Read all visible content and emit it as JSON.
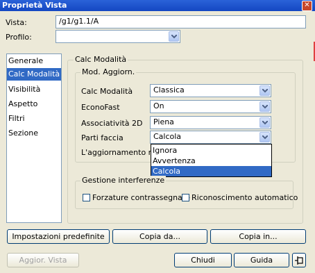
{
  "window": {
    "title": "Proprietà Vista"
  },
  "vista": {
    "label": "Vista:",
    "value": "/g1/g1.1/A"
  },
  "profilo": {
    "label": "Profilo:",
    "value": ""
  },
  "sidebar": {
    "items": [
      {
        "label": "Generale"
      },
      {
        "label": "Calc Modalità",
        "selected": true
      },
      {
        "label": "Visibilità"
      },
      {
        "label": "Aspetto"
      },
      {
        "label": "Filtri"
      },
      {
        "label": "Sezione"
      }
    ]
  },
  "calc": {
    "group_label": "Calc Modalità",
    "mod_group_label": "Mod. Aggiorn.",
    "rows": [
      {
        "label": "Calc Modalità",
        "value": "Classica"
      },
      {
        "label": "EconoFast",
        "value": "On"
      },
      {
        "label": "Associatività 2D",
        "value": "Piena"
      },
      {
        "label": "Parti faccia",
        "value": "Calcola"
      }
    ],
    "truncated_label": "L'aggiornamento mar",
    "dropdown_options": [
      "Ignora",
      "Avvertenza",
      "Calcola"
    ],
    "dropdown_selected": "Calcola"
  },
  "interferenze": {
    "group_label": "Gestione interferenze",
    "forzature_label": "Forzature contrassegnate",
    "riconoscimento_label": "Riconoscimento automatico"
  },
  "buttons": {
    "impostazioni": "Impostazioni predefinite",
    "copia_da": "Copia da...",
    "copia_in": "Copia in...",
    "aggior_vista": "Aggior. Vista",
    "chiudi": "Chiudi",
    "guida": "Guida"
  },
  "icons": {
    "close": "close-icon",
    "pin": "pin-icon",
    "dropdown": "chevron-down-icon"
  },
  "colors": {
    "title_bar": "#2a62d8",
    "selection": "#316ac5",
    "dialog_bg": "#ece9d8"
  }
}
